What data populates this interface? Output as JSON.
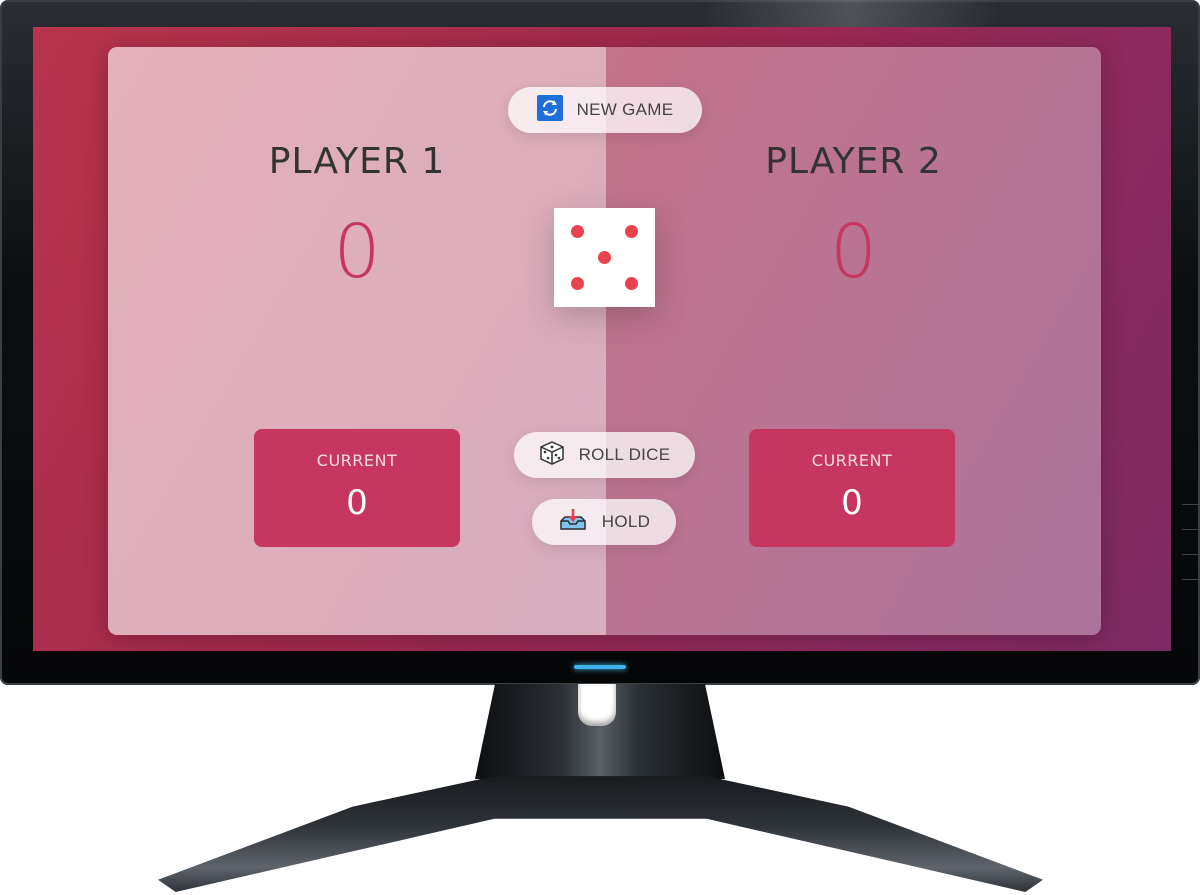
{
  "game": {
    "new_game_label": "NEW GAME",
    "roll_dice_label": "ROLL DICE",
    "hold_label": "HOLD",
    "dice_face": 5
  },
  "players": [
    {
      "name": "PLAYER 1",
      "score": "0",
      "current_label": "CURRENT",
      "current": "0",
      "active": true
    },
    {
      "name": "PLAYER 2",
      "score": "0",
      "current_label": "CURRENT",
      "current": "0",
      "active": false
    }
  ],
  "colors": {
    "accent": "#c7365f",
    "dice_pip": "#e8434f",
    "new_game_icon": "#1e6fd9",
    "power_led": "#3fb4ea"
  },
  "icons": {
    "new_game": "refresh-icon",
    "roll_dice": "dice-icon",
    "hold": "inbox-download-icon"
  }
}
